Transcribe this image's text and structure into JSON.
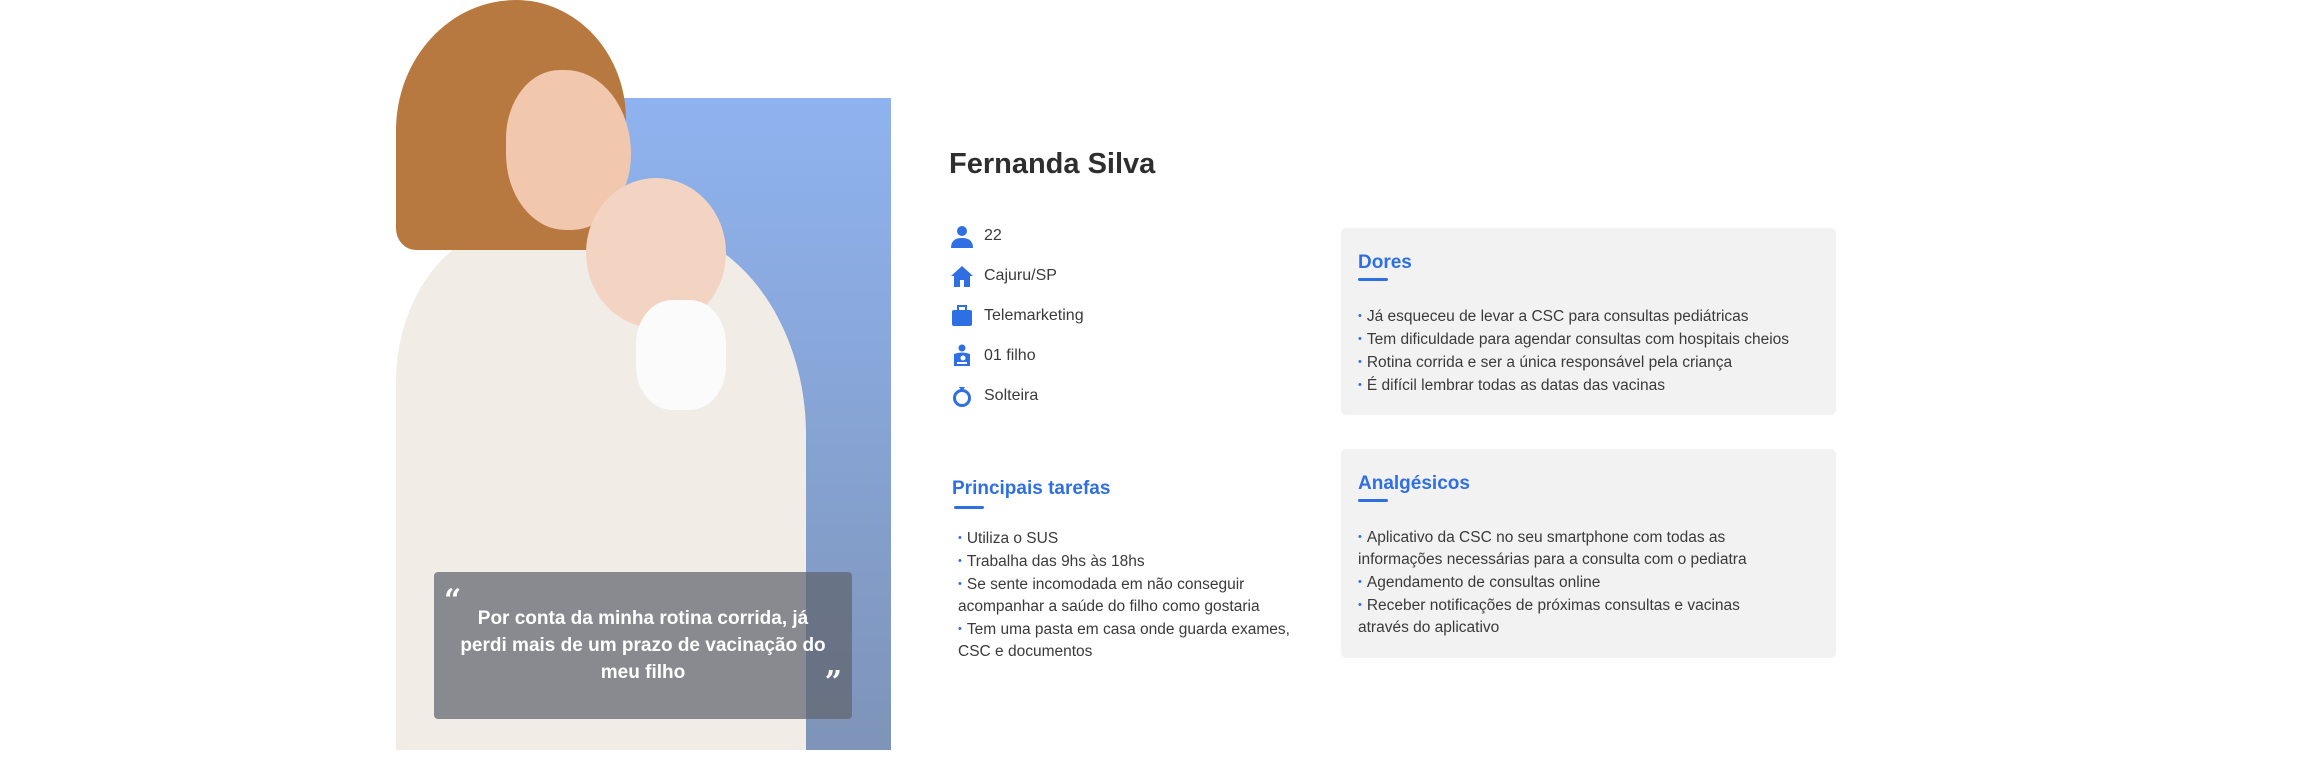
{
  "persona": {
    "name": "Fernanda Silva",
    "quote": "Por conta da minha rotina corrida, já perdi mais de um prazo de vacinação do meu filho",
    "quote_open": "“",
    "quote_close": "”",
    "info": [
      {
        "icon": "person-icon",
        "value": "22"
      },
      {
        "icon": "home-icon",
        "value": "Cajuru/SP"
      },
      {
        "icon": "briefcase-icon",
        "value": "Telemarketing"
      },
      {
        "icon": "child-icon",
        "value": "01 filho"
      },
      {
        "icon": "ring-icon",
        "value": "Solteira"
      }
    ]
  },
  "tasks": {
    "title": "Principais tarefas",
    "items": [
      "Utiliza o SUS",
      "Trabalha das 9hs às 18hs",
      "Se sente incomodada em não conseguir acompanhar a saúde do filho como gostaria",
      "Tem uma pasta em casa onde guarda exames, CSC e documentos"
    ]
  },
  "pains": {
    "title": "Dores",
    "items": [
      "Já esqueceu de levar a CSC para consultas pediátricas",
      "Tem dificuldade para agendar consultas com hospitais cheios",
      "Rotina corrida e ser a única responsável pela criança",
      "É difícil lembrar todas as datas das vacinas"
    ]
  },
  "gains": {
    "title": "Analgésicos",
    "items": [
      "Aplicativo da CSC no seu smartphone com todas as informações necessárias para a consulta com o pediatra",
      "Agendamento de consultas online",
      "Receber notificações de próximas consultas e vacinas através do aplicativo"
    ]
  },
  "colors": {
    "accent": "#2f6fe4",
    "card_bg": "#f2f2f2",
    "panel": "#8fb3f0"
  }
}
